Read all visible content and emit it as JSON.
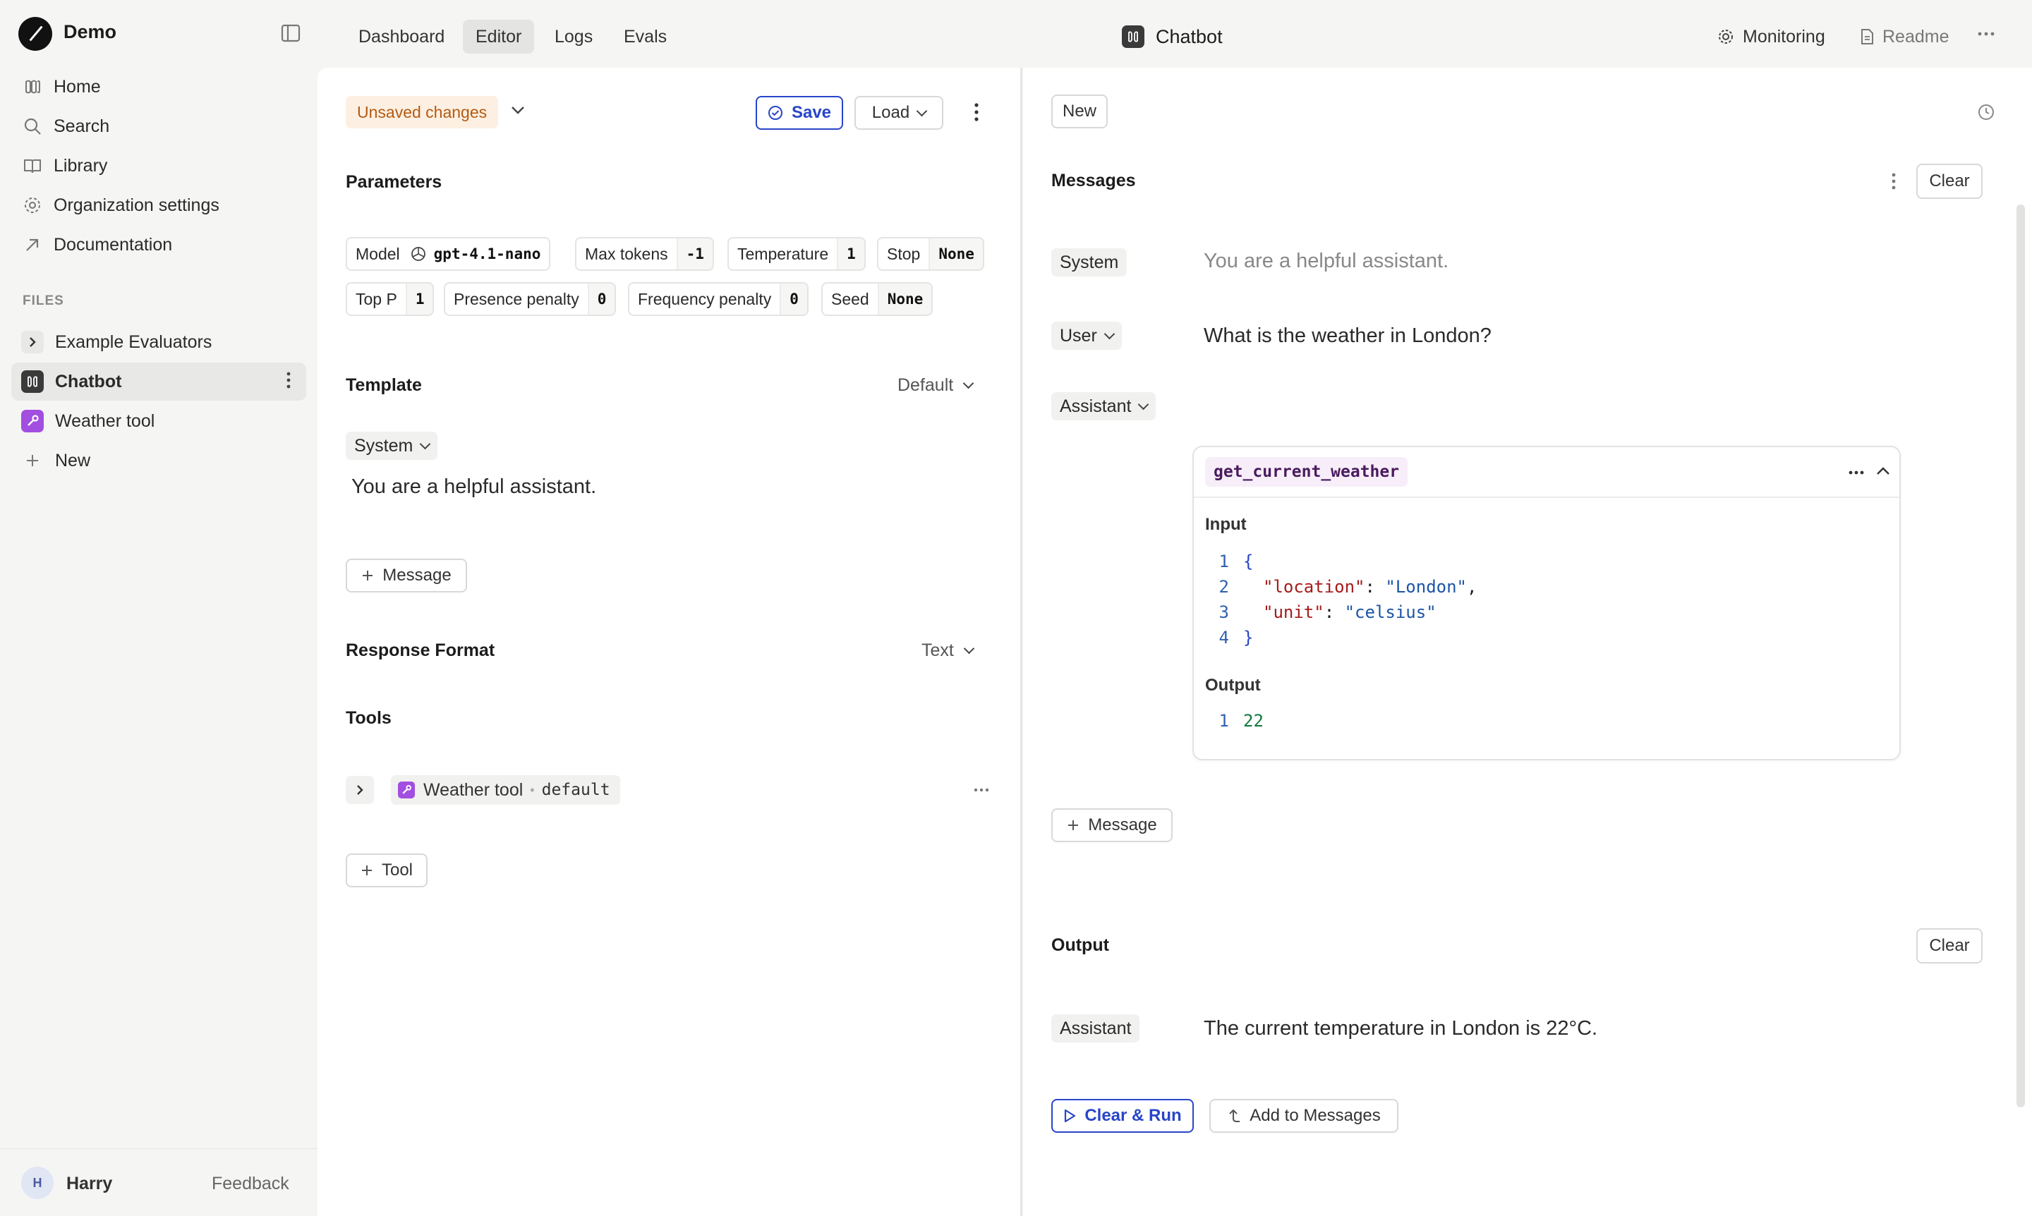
{
  "app": {
    "name": "Demo"
  },
  "sidebar": {
    "nav": [
      {
        "label": "Home",
        "icon": "home-icon"
      },
      {
        "label": "Search",
        "icon": "search-icon"
      },
      {
        "label": "Library",
        "icon": "book-icon"
      },
      {
        "label": "Organization settings",
        "icon": "gear-icon"
      },
      {
        "label": "Documentation",
        "icon": "external-arrow-icon"
      }
    ],
    "files_label": "FILES",
    "files": [
      {
        "label": "Example Evaluators",
        "icon": "chevron-right-icon"
      },
      {
        "label": "Chatbot",
        "icon": "prompt-icon",
        "active": true
      },
      {
        "label": "Weather tool",
        "icon": "wrench-icon"
      },
      {
        "label": "New",
        "icon": "plus-icon"
      }
    ],
    "user": {
      "initial": "H",
      "name": "Harry"
    },
    "feedback": "Feedback"
  },
  "topbar": {
    "tabs": [
      "Dashboard",
      "Editor",
      "Logs",
      "Evals"
    ],
    "active_tab": "Editor",
    "title": "Chatbot",
    "monitoring": "Monitoring",
    "readme": "Readme"
  },
  "editor": {
    "unsaved": "Unsaved changes",
    "save": "Save",
    "load": "Load",
    "parameters_title": "Parameters",
    "params_row1": [
      {
        "key": "Model",
        "value": "gpt-4.1-nano"
      },
      {
        "key": "Max tokens",
        "value": "-1"
      },
      {
        "key": "Temperature",
        "value": "1"
      },
      {
        "key": "Stop",
        "value": "None"
      }
    ],
    "params_row2": [
      {
        "key": "Top P",
        "value": "1"
      },
      {
        "key": "Presence penalty",
        "value": "0"
      },
      {
        "key": "Frequency penalty",
        "value": "0"
      },
      {
        "key": "Seed",
        "value": "None"
      }
    ],
    "template_title": "Template",
    "template_select": "Default",
    "template_role": "System",
    "template_text": "You are a helpful assistant.",
    "add_message": "Message",
    "response_format_title": "Response Format",
    "response_format_value": "Text",
    "tools_title": "Tools",
    "tool_name": "Weather tool",
    "tool_sep": "•",
    "tool_version": "default",
    "add_tool": "Tool"
  },
  "chat": {
    "new_button": "New",
    "messages_title": "Messages",
    "clear": "Clear",
    "messages": [
      {
        "role": "System",
        "text": "You are a helpful assistant."
      },
      {
        "role": "User",
        "text": "What is the weather in London?"
      },
      {
        "role": "Assistant",
        "text": ""
      }
    ],
    "tool_call": {
      "name": "get_current_weather",
      "input_label": "Input",
      "input_lines": [
        {
          "n": "1",
          "brace": "{"
        },
        {
          "n": "2",
          "key": "\"location\"",
          "colon": ": ",
          "val": "\"London\"",
          "comma": ","
        },
        {
          "n": "3",
          "key": "\"unit\"",
          "colon": ": ",
          "val": "\"celsius\"",
          "comma": ""
        },
        {
          "n": "4",
          "brace": "}"
        }
      ],
      "output_label": "Output",
      "output_lines": [
        {
          "n": "1",
          "val": "22"
        }
      ]
    },
    "add_message": "Message",
    "output_title": "Output",
    "output_clear": "Clear",
    "output_role": "Assistant",
    "output_text": "The current temperature in London is 22°C.",
    "clear_run": "Clear & Run",
    "add_to_messages": "Add to Messages"
  },
  "colors": {
    "accent": "#2845c9",
    "unsaved_bg": "#fdf0e2",
    "unsaved_text": "#b45a12",
    "prompt_badge": "#3a3a3a",
    "tool_badge": "#a24ee0"
  }
}
